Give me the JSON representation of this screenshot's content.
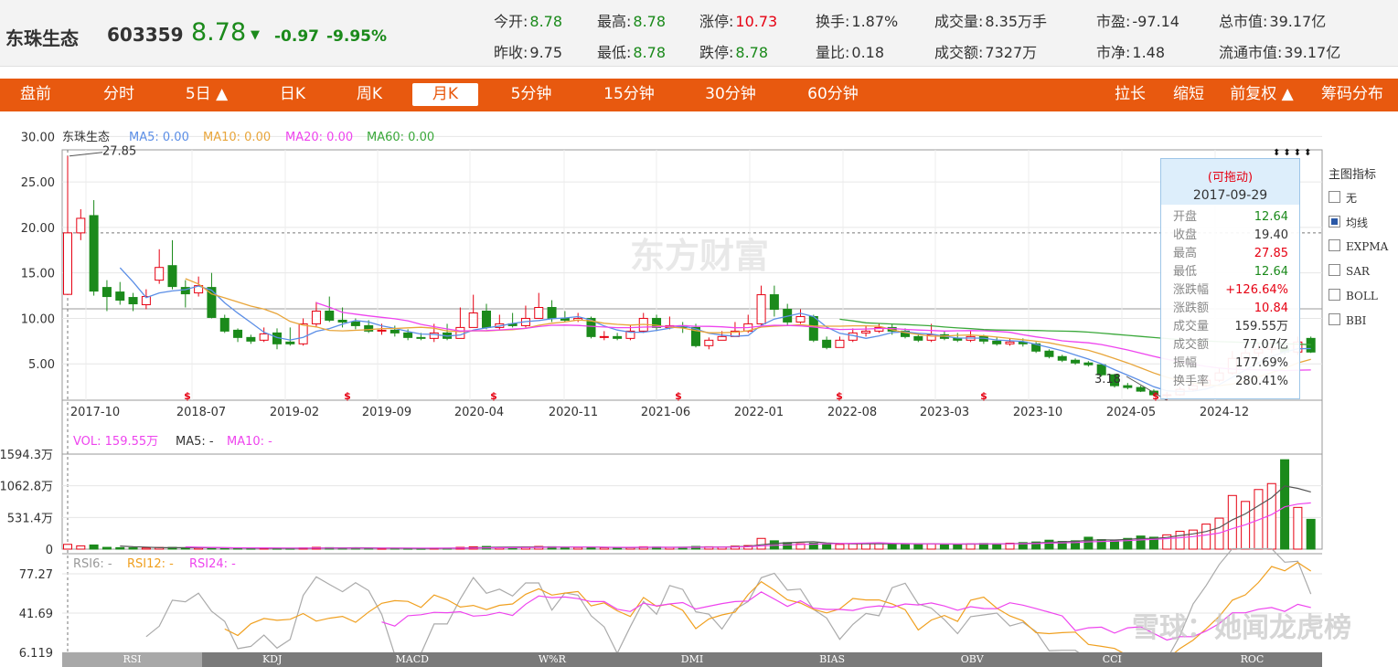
{
  "header": {
    "name": "东珠生态",
    "code": "603359",
    "price": "8.78",
    "arrow": "▼",
    "change": "-0.97",
    "pct": "-9.95%",
    "quotes_row1": [
      {
        "label": "今开:",
        "value": "8.78",
        "color": "g"
      },
      {
        "label": "最高:",
        "value": "8.78",
        "color": "g"
      },
      {
        "label": "涨停:",
        "value": "10.73",
        "color": "r"
      },
      {
        "label": "换手:",
        "value": "1.87%",
        "color": "k"
      },
      {
        "label": "成交量:",
        "value": "8.35万手",
        "color": "k"
      },
      {
        "label": "市盈:",
        "value": "-97.14",
        "color": "k"
      },
      {
        "label": "总市值:",
        "value": "39.17亿",
        "color": "k"
      }
    ],
    "quotes_row2": [
      {
        "label": "昨收:",
        "value": "9.75",
        "color": "k"
      },
      {
        "label": "最低:",
        "value": "8.78",
        "color": "g"
      },
      {
        "label": "跌停:",
        "value": "8.78",
        "color": "g"
      },
      {
        "label": "量比:",
        "value": "0.18",
        "color": "k"
      },
      {
        "label": "成交额:",
        "value": "7327万",
        "color": "k"
      },
      {
        "label": "市净:",
        "value": "1.48",
        "color": "k"
      },
      {
        "label": "流通市值:",
        "value": "39.17亿",
        "color": "k"
      }
    ]
  },
  "toolbar": {
    "left": [
      "盘前",
      "分时",
      "5日 ▲",
      "日K",
      "周K",
      "月K",
      "5分钟",
      "15分钟",
      "30分钟",
      "60分钟"
    ],
    "active": "月K",
    "right": [
      "拉长",
      "缩短",
      "前复权 ▲",
      "筹码分布"
    ]
  },
  "main_legend": {
    "name": "东珠生态",
    "ma5": "MA5: 0.00",
    "ma10": "MA10: 0.00",
    "ma20": "MA20: 0.00",
    "ma60": "MA60: 0.00"
  },
  "vol_legend": {
    "vol": "VOL: 159.55万",
    "ma5": "MA5: -",
    "ma10": "MA10: -"
  },
  "rsi_legend": {
    "rsi6": "RSI6: -",
    "rsi12": "RSI12: -",
    "rsi24": "RSI24: -"
  },
  "price_axis": [
    "30.00",
    "25.00",
    "20.00",
    "15.00",
    "10.00",
    "5.00"
  ],
  "vol_axis": [
    "1594.3万",
    "1062.8万",
    "531.4万",
    "0"
  ],
  "rsi_axis": [
    "77.27",
    "41.69",
    "6.119"
  ],
  "date_axis": [
    "2017-10",
    "2018-07",
    "2019-02",
    "2019-09",
    "2020-04",
    "2020-11",
    "2021-06",
    "2022-01",
    "2022-08",
    "2023-03",
    "2023-10",
    "2024-05",
    "2024-12"
  ],
  "annotations": {
    "high": "27.85",
    "low": "3.18"
  },
  "watermark": "东方财富",
  "corner_watermark": "雪球：她闻龙虎榜",
  "tooltip": {
    "drag": "(可拖动)",
    "date": "2017-09-29",
    "rows": [
      {
        "name": "开盘",
        "value": "12.64",
        "color": "g"
      },
      {
        "name": "收盘",
        "value": "19.40",
        "color": "k"
      },
      {
        "name": "最高",
        "value": "27.85",
        "color": "r"
      },
      {
        "name": "最低",
        "value": "12.64",
        "color": "g"
      },
      {
        "name": "涨跌幅",
        "value": "+126.64%",
        "color": "r"
      },
      {
        "name": "涨跌额",
        "value": "10.84",
        "color": "r"
      },
      {
        "name": "成交量",
        "value": "159.55万",
        "color": "k"
      },
      {
        "name": "成交额",
        "value": "77.07亿",
        "color": "k"
      },
      {
        "name": "振幅",
        "value": "177.69%",
        "color": "k"
      },
      {
        "name": "换手率",
        "value": "280.41%",
        "color": "k"
      }
    ]
  },
  "indicators": {
    "title": "主图指标",
    "items": [
      {
        "label": "无",
        "checked": false
      },
      {
        "label": "均线",
        "checked": true
      },
      {
        "label": "EXPMA",
        "checked": false
      },
      {
        "label": "SAR",
        "checked": false
      },
      {
        "label": "BOLL",
        "checked": false
      },
      {
        "label": "BBI",
        "checked": false
      }
    ]
  },
  "bottom_tabs": [
    "RSI",
    "KDJ",
    "MACD",
    "W%R",
    "DMI",
    "BIAS",
    "OBV",
    "CCI",
    "ROC"
  ],
  "colors": {
    "accent": "#e8590f",
    "up": "#e60012",
    "down": "#1b8a1b",
    "ma5": "#5b8ee6",
    "ma10": "#e8a53a",
    "ma20": "#ee44ee",
    "ma60": "#3aa83a"
  },
  "chart_data": {
    "type": "candlestick",
    "period": "monthly",
    "ylim": [
      0,
      30
    ],
    "candles": [
      [
        12.64,
        19.4,
        27.85,
        12.64
      ],
      [
        19.4,
        21.0,
        22.0,
        18.6
      ],
      [
        21.3,
        13.0,
        23.0,
        12.5
      ],
      [
        13.4,
        12.4,
        14.2,
        10.8
      ],
      [
        12.9,
        12.0,
        14.0,
        11.5
      ],
      [
        12.3,
        11.6,
        12.8,
        10.8
      ],
      [
        11.5,
        12.4,
        13.2,
        11.0
      ],
      [
        14.2,
        15.6,
        17.6,
        13.8
      ],
      [
        15.8,
        13.5,
        18.6,
        13.2
      ],
      [
        13.4,
        12.7,
        14.2,
        11.2
      ],
      [
        12.8,
        13.6,
        14.6,
        12.4
      ],
      [
        13.4,
        10.1,
        15.0,
        10.0
      ],
      [
        10.0,
        8.6,
        10.4,
        8.4
      ],
      [
        8.7,
        7.9,
        8.9,
        7.4
      ],
      [
        7.9,
        7.5,
        8.2,
        7.2
      ],
      [
        7.6,
        8.3,
        9.0,
        7.4
      ],
      [
        8.4,
        7.2,
        8.9,
        6.6
      ],
      [
        7.4,
        7.2,
        9.0,
        7.0
      ],
      [
        7.2,
        9.4,
        10.0,
        7.0
      ],
      [
        9.4,
        10.8,
        11.8,
        9.0
      ],
      [
        10.8,
        9.8,
        12.4,
        9.6
      ],
      [
        9.8,
        9.6,
        11.2,
        9.0
      ],
      [
        9.6,
        9.2,
        10.0,
        8.8
      ],
      [
        9.2,
        8.6,
        9.8,
        8.4
      ],
      [
        8.6,
        8.7,
        9.4,
        8.2
      ],
      [
        8.7,
        8.4,
        9.2,
        8.0
      ],
      [
        8.4,
        7.9,
        8.8,
        7.6
      ],
      [
        7.9,
        7.8,
        8.4,
        7.6
      ],
      [
        7.8,
        8.4,
        9.4,
        7.4
      ],
      [
        8.4,
        7.8,
        9.4,
        7.6
      ],
      [
        7.8,
        9.0,
        11.2,
        7.8
      ],
      [
        9.0,
        10.6,
        12.6,
        9.0
      ],
      [
        10.8,
        9.0,
        11.6,
        8.8
      ],
      [
        9.0,
        9.4,
        10.4,
        8.8
      ],
      [
        9.4,
        9.2,
        10.6,
        9.0
      ],
      [
        9.2,
        10.0,
        11.4,
        9.0
      ],
      [
        10.0,
        11.2,
        12.8,
        10.0
      ],
      [
        11.2,
        10.0,
        12.0,
        9.6
      ],
      [
        10.0,
        9.8,
        10.8,
        9.6
      ],
      [
        9.8,
        10.0,
        10.6,
        9.6
      ],
      [
        10.0,
        8.0,
        10.2,
        7.8
      ],
      [
        8.0,
        8.0,
        8.6,
        7.6
      ],
      [
        8.0,
        7.8,
        8.4,
        7.6
      ],
      [
        7.8,
        8.6,
        9.2,
        7.6
      ],
      [
        8.6,
        10.0,
        10.6,
        8.4
      ],
      [
        10.0,
        9.0,
        10.4,
        8.6
      ],
      [
        9.0,
        9.2,
        10.2,
        8.8
      ],
      [
        9.2,
        9.0,
        9.6,
        8.4
      ],
      [
        9.0,
        7.0,
        9.4,
        6.8
      ],
      [
        7.0,
        7.6,
        7.9,
        6.6
      ],
      [
        7.6,
        8.0,
        8.6,
        7.6
      ],
      [
        8.0,
        8.6,
        9.6,
        8.0
      ],
      [
        8.6,
        9.4,
        10.4,
        8.4
      ],
      [
        9.4,
        12.6,
        13.6,
        9.2
      ],
      [
        12.6,
        11.0,
        13.6,
        10.2
      ],
      [
        11.0,
        9.6,
        11.6,
        9.2
      ],
      [
        9.6,
        10.2,
        11.0,
        9.4
      ],
      [
        10.2,
        7.6,
        10.4,
        7.4
      ],
      [
        7.6,
        6.8,
        8.0,
        6.6
      ],
      [
        6.8,
        7.6,
        8.0,
        6.8
      ],
      [
        7.6,
        8.4,
        8.9,
        7.4
      ],
      [
        8.4,
        8.6,
        9.2,
        8.0
      ],
      [
        8.6,
        9.0,
        9.4,
        8.4
      ],
      [
        9.0,
        8.6,
        9.4,
        8.2
      ],
      [
        8.6,
        8.0,
        8.9,
        7.8
      ],
      [
        8.0,
        7.6,
        8.4,
        7.4
      ],
      [
        7.6,
        8.2,
        9.4,
        7.4
      ],
      [
        8.2,
        7.8,
        8.6,
        7.6
      ],
      [
        7.8,
        7.6,
        8.4,
        7.4
      ],
      [
        7.6,
        8.0,
        8.6,
        7.4
      ],
      [
        8.0,
        7.5,
        8.2,
        7.2
      ],
      [
        7.5,
        7.2,
        7.9,
        7.0
      ],
      [
        7.2,
        7.4,
        7.8,
        7.0
      ],
      [
        7.4,
        7.2,
        7.8,
        6.9
      ],
      [
        7.2,
        6.4,
        7.4,
        6.2
      ],
      [
        6.4,
        5.8,
        6.6,
        5.6
      ],
      [
        5.8,
        5.4,
        6.0,
        5.2
      ],
      [
        5.4,
        5.1,
        5.6,
        4.9
      ],
      [
        5.1,
        4.9,
        5.3,
        4.7
      ],
      [
        4.9,
        3.8,
        5.0,
        3.6
      ],
      [
        3.8,
        2.6,
        3.9,
        2.4
      ],
      [
        2.6,
        2.4,
        2.9,
        2.2
      ],
      [
        2.4,
        2.0,
        2.6,
        1.9
      ],
      [
        2.0,
        1.6,
        2.2,
        1.5
      ],
      [
        1.6,
        1.6,
        1.9,
        1.0
      ],
      [
        1.6,
        2.2,
        2.5,
        1.5
      ],
      [
        2.2,
        2.6,
        2.9,
        2.0
      ],
      [
        2.6,
        3.2,
        3.6,
        2.5
      ],
      [
        3.2,
        4.0,
        4.6,
        3.0
      ],
      [
        4.0,
        5.6,
        6.4,
        3.8
      ],
      [
        5.6,
        6.2,
        7.0,
        5.2
      ],
      [
        6.2,
        6.6,
        7.2,
        5.8
      ],
      [
        6.6,
        6.8,
        7.4,
        6.2
      ],
      [
        6.8,
        6.3,
        7.6,
        6.0
      ],
      [
        6.3,
        7.4,
        8.0,
        6.0
      ],
      [
        7.8,
        6.3,
        8.0,
        6.2
      ]
    ],
    "volume": [
      80,
      55,
      70,
      30,
      25,
      22,
      20,
      28,
      30,
      22,
      20,
      25,
      18,
      15,
      14,
      16,
      14,
      14,
      20,
      30,
      25,
      20,
      18,
      16,
      14,
      15,
      14,
      13,
      16,
      15,
      30,
      40,
      45,
      30,
      28,
      35,
      45,
      40,
      30,
      28,
      30,
      25,
      22,
      28,
      40,
      35,
      30,
      28,
      45,
      40,
      35,
      50,
      60,
      180,
      140,
      110,
      90,
      100,
      85,
      80,
      90,
      95,
      100,
      90,
      85,
      80,
      90,
      85,
      80,
      90,
      95,
      90,
      100,
      110,
      120,
      150,
      130,
      140,
      200,
      160,
      140,
      180,
      220,
      200,
      240,
      300,
      320,
      420,
      520,
      900,
      800,
      1000,
      1100,
      1500,
      700,
      500
    ]
  }
}
